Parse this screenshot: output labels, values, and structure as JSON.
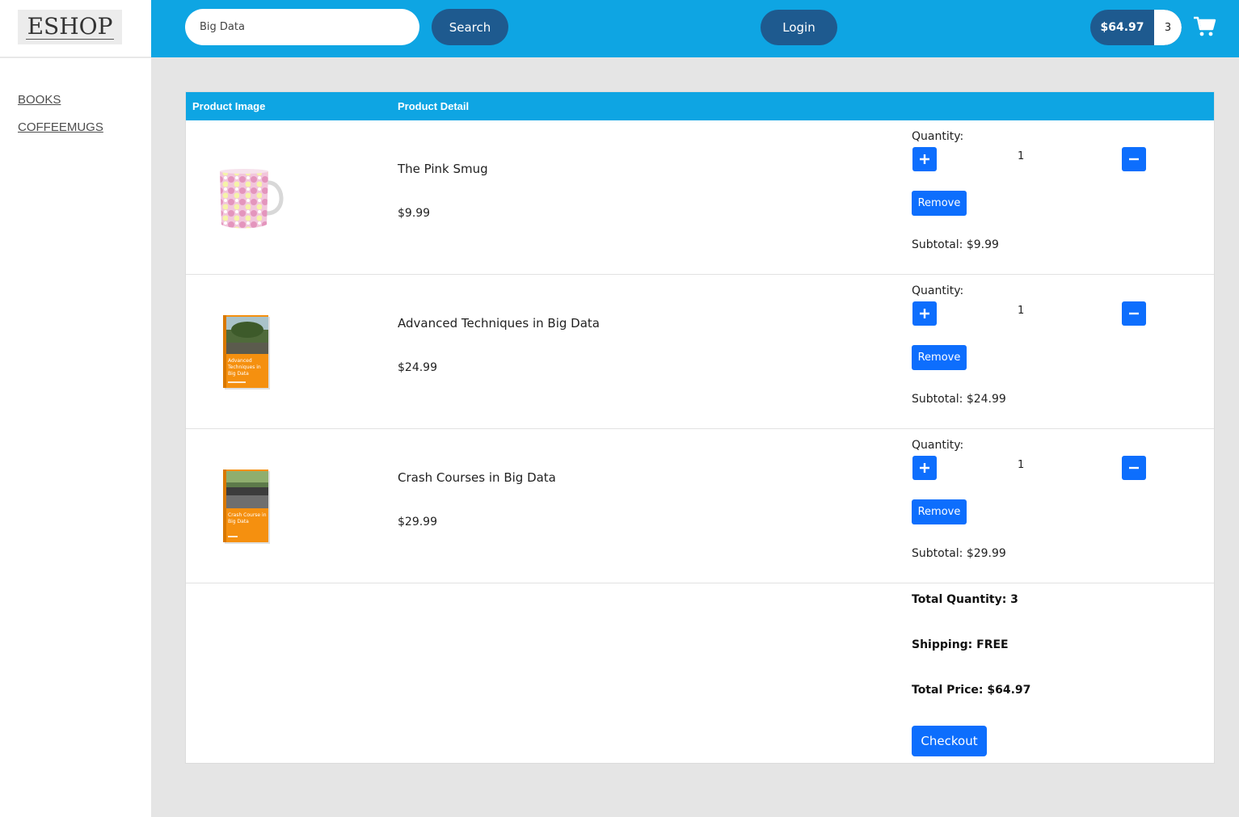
{
  "brand": {
    "logo_text": "ESHOP"
  },
  "sidebar": {
    "items": [
      {
        "label": "BOOKS"
      },
      {
        "label": "COFFEEMUGS"
      }
    ]
  },
  "header": {
    "search_value": "Big Data",
    "search_button": "Search",
    "login_button": "Login",
    "cart_price": "$64.97",
    "cart_count": "3",
    "cart_icon": "shopping-cart-icon",
    "accent_color": "#0ea5e3",
    "button_color": "#1e5a8f"
  },
  "table": {
    "columns": [
      "Product Image",
      "Product Detail"
    ],
    "rows": [
      {
        "name": "The Pink Smug",
        "price": "$9.99",
        "quantity_label": "Quantity:",
        "quantity": "1",
        "remove_label": "Remove",
        "subtotal": "Subtotal: $9.99",
        "image": "mug-image"
      },
      {
        "name": "Advanced Techniques in Big Data",
        "price": "$24.99",
        "quantity_label": "Quantity:",
        "quantity": "1",
        "remove_label": "Remove",
        "subtotal": "Subtotal: $24.99",
        "image": "book-cover-image",
        "cover_text": "Advanced Techniques in Big Data"
      },
      {
        "name": "Crash Courses in Big Data",
        "price": "$29.99",
        "quantity_label": "Quantity:",
        "quantity": "1",
        "remove_label": "Remove",
        "subtotal": "Subtotal: $29.99",
        "image": "book-cover-image",
        "cover_text": "Crash Course in Big Data"
      }
    ],
    "button_color": "#0d6efd"
  },
  "summary": {
    "total_quantity": "Total Quantity: 3",
    "shipping": "Shipping: FREE",
    "total_price": "Total Price: $64.97",
    "checkout_label": "Checkout"
  }
}
